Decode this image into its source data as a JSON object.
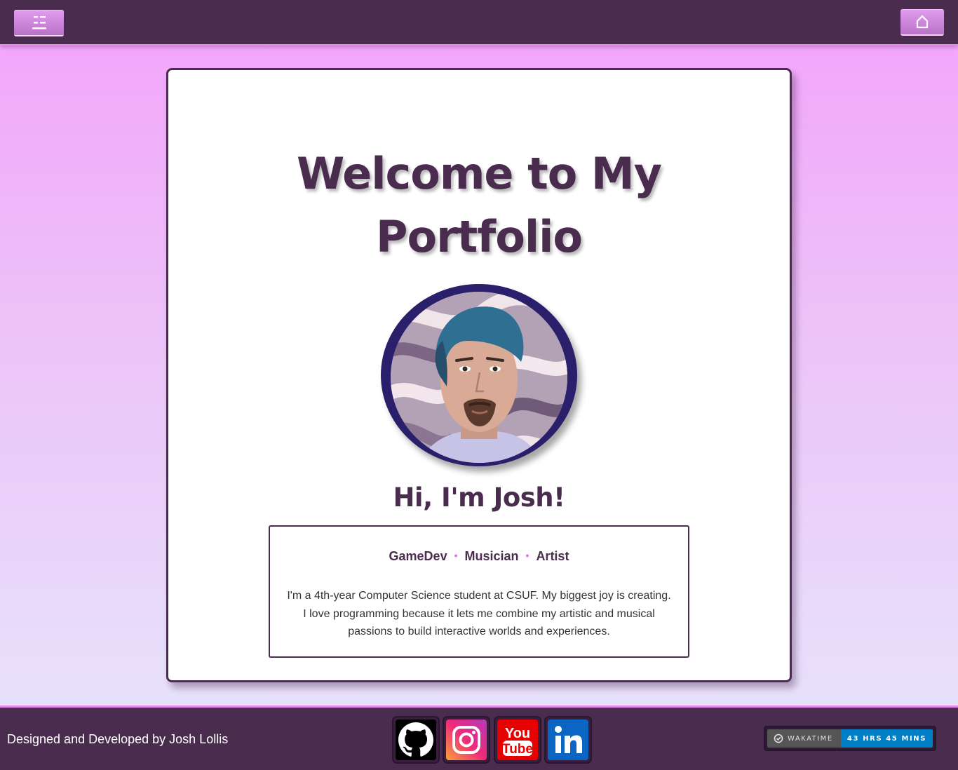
{
  "nav": {
    "menu_icon": "menu-icon",
    "home_icon": "home-icon"
  },
  "hero": {
    "title_line1": "Welcome to My",
    "title_line2": "Portfolio",
    "greeting": "Hi, I'm Josh!"
  },
  "bio": {
    "tags": [
      "GameDev",
      "Musician",
      "Artist"
    ],
    "line1": "I'm a 4th-year Computer Science student at CSUF. My biggest joy is creating.",
    "line2": "I love programming because it lets me combine my artistic and musical",
    "line3": "passions to build interactive worlds and experiences."
  },
  "footer": {
    "credit": "Designed and Developed by Josh Lollis",
    "social": [
      {
        "name": "github-icon",
        "color": "#000000"
      },
      {
        "name": "instagram-icon",
        "color": "#e1306c"
      },
      {
        "name": "youtube-icon",
        "color": "#ff0000"
      },
      {
        "name": "linkedin-icon",
        "color": "#0a66c2"
      }
    ],
    "wakatime_label": "WAKATIME",
    "wakatime_value": "43 HRS 45 MINS"
  },
  "colors": {
    "primary": "#4a2d4e",
    "accent": "#e78af0",
    "badge_blue": "#007ec6"
  }
}
